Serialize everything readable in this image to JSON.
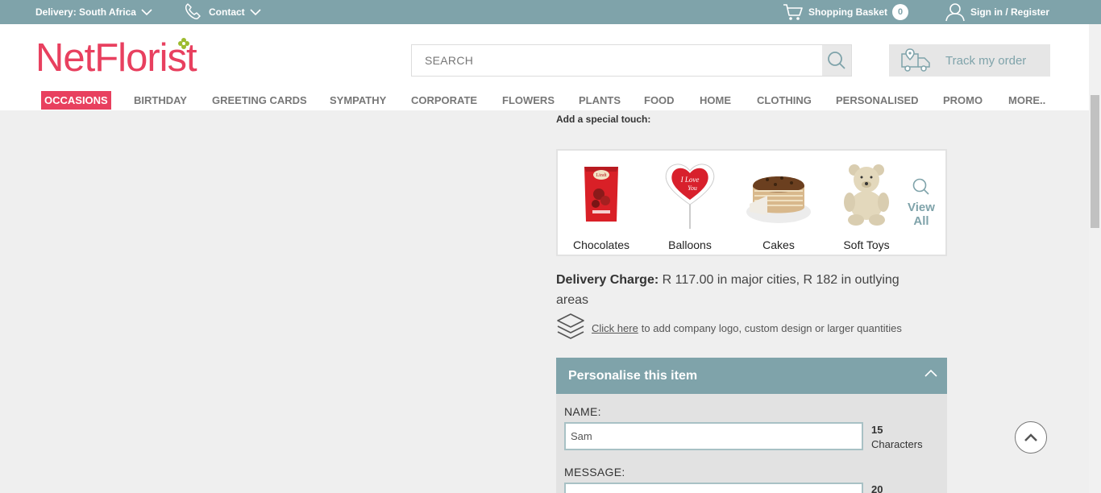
{
  "topbar": {
    "delivery_label": "Delivery: South Africa",
    "contact_label": "Contact",
    "basket_label": "Shopping Basket",
    "basket_count": "0",
    "signin_label": "Sign in / Register"
  },
  "header": {
    "logo_text": "NetFlorist",
    "search_placeholder": "SEARCH",
    "track_label": "Track my order"
  },
  "nav": {
    "items": [
      "OCCASIONS",
      "BIRTHDAY",
      "GREETING CARDS",
      "SYMPATHY",
      "CORPORATE",
      "FLOWERS",
      "PLANTS",
      "FOOD",
      "HOME",
      "CLOTHING",
      "PERSONALISED",
      "PROMO",
      "MORE.."
    ],
    "active": "OCCASIONS"
  },
  "special": {
    "title": "Add a special touch:",
    "items": [
      {
        "label": "Chocolates",
        "icon": "chocolate-box-icon"
      },
      {
        "label": "Balloons",
        "icon": "heart-balloon-icon"
      },
      {
        "label": "Cakes",
        "icon": "cake-icon"
      },
      {
        "label": "Soft Toys",
        "icon": "teddy-bear-icon"
      }
    ],
    "view_all_line1": "View",
    "view_all_line2": "All"
  },
  "delivery": {
    "label": "Delivery Charge:",
    "text": " R 117.00 in major cities, R 182 in outlying areas"
  },
  "custom": {
    "link": "Click here",
    "text": "to add company logo, custom design or larger quantities"
  },
  "personalise": {
    "title": "Personalise this item",
    "name_label": "NAME:",
    "name_value": "Sam",
    "name_count": "15",
    "name_count_unit": "Characters",
    "message_label": "MESSAGE:",
    "message_count": "20"
  },
  "colors": {
    "brand_pink": "#e8405f",
    "teal": "#7fa3aa"
  }
}
